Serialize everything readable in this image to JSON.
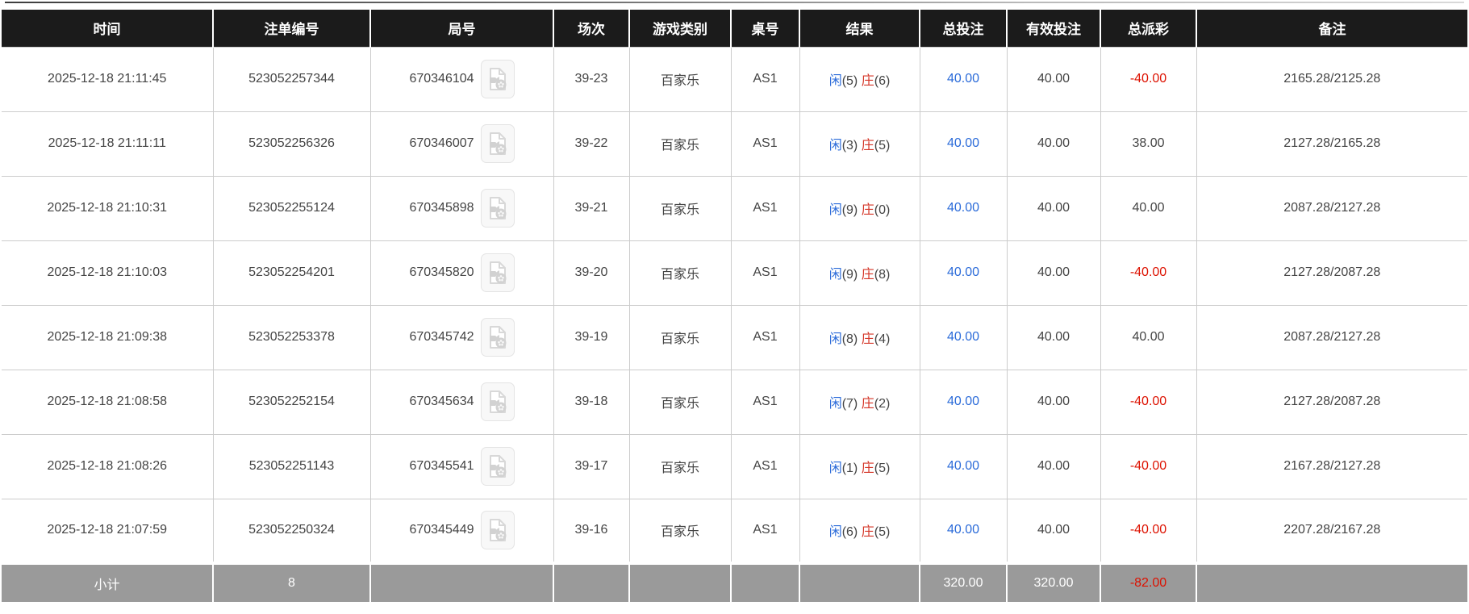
{
  "table": {
    "columns": [
      {
        "key": "time",
        "label": "时间"
      },
      {
        "key": "bet_no",
        "label": "注单编号"
      },
      {
        "key": "round_no",
        "label": "局号"
      },
      {
        "key": "session",
        "label": "场次"
      },
      {
        "key": "game",
        "label": "游戏类别"
      },
      {
        "key": "table_no",
        "label": "桌号"
      },
      {
        "key": "result",
        "label": "结果"
      },
      {
        "key": "total_bet",
        "label": "总投注"
      },
      {
        "key": "valid_bet",
        "label": "有效投注"
      },
      {
        "key": "payout",
        "label": "总派彩"
      },
      {
        "key": "note",
        "label": "备注"
      }
    ],
    "rows": [
      {
        "time": "2025-12-18 21:11:45",
        "bet_no": "523052257344",
        "round_no": "670346104",
        "session": "39-23",
        "game": "百家乐",
        "table_no": "AS1",
        "player_label": "闲",
        "player_score": "(5)",
        "banker_label": "庄",
        "banker_score": "(6)",
        "total_bet": "40.00",
        "valid_bet": "40.00",
        "payout": "-40.00",
        "note": "2165.28/2125.28"
      },
      {
        "time": "2025-12-18 21:11:11",
        "bet_no": "523052256326",
        "round_no": "670346007",
        "session": "39-22",
        "game": "百家乐",
        "table_no": "AS1",
        "player_label": "闲",
        "player_score": "(3)",
        "banker_label": "庄",
        "banker_score": "(5)",
        "total_bet": "40.00",
        "valid_bet": "40.00",
        "payout": "38.00",
        "note": "2127.28/2165.28"
      },
      {
        "time": "2025-12-18 21:10:31",
        "bet_no": "523052255124",
        "round_no": "670345898",
        "session": "39-21",
        "game": "百家乐",
        "table_no": "AS1",
        "player_label": "闲",
        "player_score": "(9)",
        "banker_label": "庄",
        "banker_score": "(0)",
        "total_bet": "40.00",
        "valid_bet": "40.00",
        "payout": "40.00",
        "note": "2087.28/2127.28"
      },
      {
        "time": "2025-12-18 21:10:03",
        "bet_no": "523052254201",
        "round_no": "670345820",
        "session": "39-20",
        "game": "百家乐",
        "table_no": "AS1",
        "player_label": "闲",
        "player_score": "(9)",
        "banker_label": "庄",
        "banker_score": "(8)",
        "total_bet": "40.00",
        "valid_bet": "40.00",
        "payout": "-40.00",
        "note": "2127.28/2087.28"
      },
      {
        "time": "2025-12-18 21:09:38",
        "bet_no": "523052253378",
        "round_no": "670345742",
        "session": "39-19",
        "game": "百家乐",
        "table_no": "AS1",
        "player_label": "闲",
        "player_score": "(8)",
        "banker_label": "庄",
        "banker_score": "(4)",
        "total_bet": "40.00",
        "valid_bet": "40.00",
        "payout": "40.00",
        "note": "2087.28/2127.28"
      },
      {
        "time": "2025-12-18 21:08:58",
        "bet_no": "523052252154",
        "round_no": "670345634",
        "session": "39-18",
        "game": "百家乐",
        "table_no": "AS1",
        "player_label": "闲",
        "player_score": "(7)",
        "banker_label": "庄",
        "banker_score": "(2)",
        "total_bet": "40.00",
        "valid_bet": "40.00",
        "payout": "-40.00",
        "note": "2127.28/2087.28"
      },
      {
        "time": "2025-12-18 21:08:26",
        "bet_no": "523052251143",
        "round_no": "670345541",
        "session": "39-17",
        "game": "百家乐",
        "table_no": "AS1",
        "player_label": "闲",
        "player_score": "(1)",
        "banker_label": "庄",
        "banker_score": "(5)",
        "total_bet": "40.00",
        "valid_bet": "40.00",
        "payout": "-40.00",
        "note": "2167.28/2127.28"
      },
      {
        "time": "2025-12-18 21:07:59",
        "bet_no": "523052250324",
        "round_no": "670345449",
        "session": "39-16",
        "game": "百家乐",
        "table_no": "AS1",
        "player_label": "闲",
        "player_score": "(6)",
        "banker_label": "庄",
        "banker_score": "(5)",
        "total_bet": "40.00",
        "valid_bet": "40.00",
        "payout": "-40.00",
        "note": "2207.28/2167.28"
      }
    ],
    "footer": {
      "label": "小计",
      "count": "8",
      "total_bet": "320.00",
      "valid_bet": "320.00",
      "payout": "-82.00"
    }
  },
  "icons": {
    "video_replay": "video-replay-icon"
  },
  "colors": {
    "accent_blue": "#2b6bd9",
    "negative_red": "#dd1100",
    "banker_red": "#d43426",
    "player_blue": "#2b6bd9",
    "header_bg": "#1b1b1b",
    "footer_bg": "#9a9a9a",
    "border_gray": "#cccccc",
    "body_text": "#444444"
  }
}
